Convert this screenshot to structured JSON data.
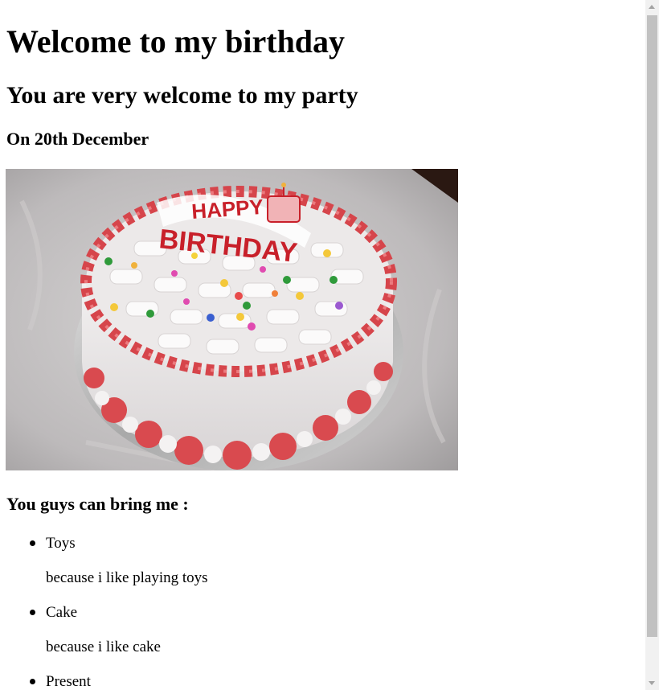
{
  "page": {
    "heading": "Welcome to my birthday",
    "subheading": "You are very welcome to my party",
    "date": "On 20th December",
    "image": {
      "icon": "birthday-cake-photo",
      "cake_text_line1": "HAPPY",
      "cake_text_line2": "BIRTHDAY"
    },
    "wishlist_heading": "You guys can bring me :",
    "wishlist": [
      {
        "item": "Toys",
        "reason": "because i like playing toys"
      },
      {
        "item": "Cake",
        "reason": "because i like cake"
      },
      {
        "item": "Present"
      }
    ]
  },
  "scrollbar": {
    "up_icon": "scroll-up-arrow-icon",
    "down_icon": "scroll-down-arrow-icon"
  }
}
